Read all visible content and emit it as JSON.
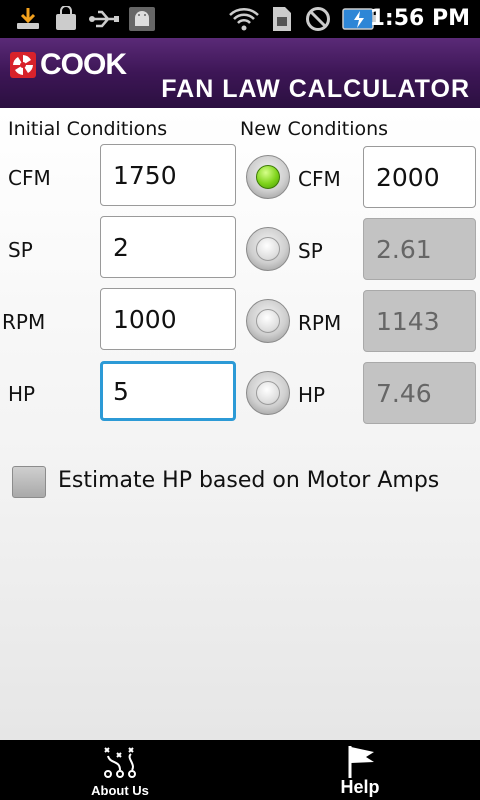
{
  "status_bar": {
    "time": "1:56 PM",
    "icons": [
      "download-icon",
      "shopping-bag-icon",
      "usb-icon",
      "android-debug-icon",
      "wifi-icon",
      "sim-icon",
      "do-not-disturb-icon",
      "battery-charging-icon"
    ]
  },
  "header": {
    "brand": "COOK",
    "subtitle": "FAN LAW CALCULATOR",
    "colors": {
      "gradient_top": "#5a2a77",
      "gradient_bottom": "#2b0f40",
      "logo_red": "#d8222b"
    }
  },
  "form": {
    "initial_heading": "Initial Conditions",
    "new_heading": "New Conditions",
    "initial": [
      {
        "label": "CFM",
        "value": "1750"
      },
      {
        "label": "SP",
        "value": "2"
      },
      {
        "label": "RPM",
        "value": "1000"
      },
      {
        "label": "HP",
        "value": "5"
      }
    ],
    "new": [
      {
        "label": "CFM",
        "value": "2000",
        "selected": true
      },
      {
        "label": "SP",
        "value": "2.61",
        "selected": false
      },
      {
        "label": "RPM",
        "value": "1143",
        "selected": false
      },
      {
        "label": "HP",
        "value": "7.46",
        "selected": false
      }
    ],
    "estimate_checkbox_label": "Estimate HP based on Motor Amps",
    "estimate_checked": false
  },
  "bottom_tabs": [
    {
      "label": "About Us",
      "icon": "play-diagram-icon"
    },
    {
      "label": "Help",
      "icon": "flag-icon"
    }
  ]
}
